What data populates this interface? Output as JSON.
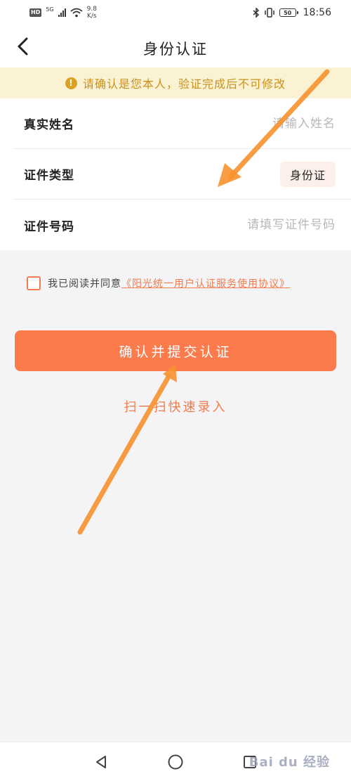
{
  "status_bar": {
    "hd": "HD",
    "net_gen": "5G",
    "speed_value": "9.8",
    "speed_unit": "K/s",
    "battery": "50",
    "time": "18:56"
  },
  "header": {
    "title": "身份认证"
  },
  "notice": {
    "text": "请确认是您本人，验证完成后不可修改"
  },
  "form": {
    "name": {
      "label": "真实姓名",
      "placeholder": "请输入姓名",
      "value": ""
    },
    "id_type": {
      "label": "证件类型",
      "value": "身份证"
    },
    "id_number": {
      "label": "证件号码",
      "placeholder": "请填写证件号码",
      "value": ""
    }
  },
  "agreement": {
    "prefix": "我已阅读并同意",
    "link": "《阳光统一用户认证服务使用协议》",
    "checked": false
  },
  "actions": {
    "submit_label": "确认并提交认证",
    "scan_label": "扫一扫快速录入"
  },
  "watermark": {
    "text": "Bai du 经验"
  },
  "colors": {
    "accent": "#fb7b4c",
    "notice_bg": "#fbf2d3",
    "notice_text": "#c9911b",
    "annotation_arrow": "#f7922f"
  }
}
